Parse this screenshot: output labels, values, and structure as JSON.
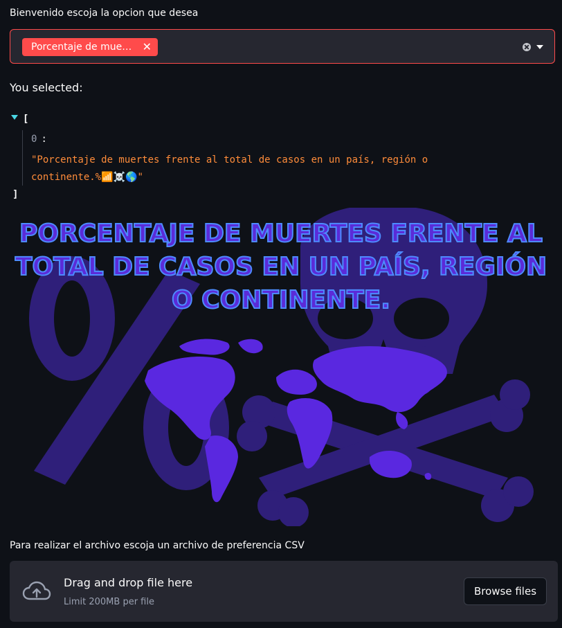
{
  "select": {
    "label": "Bienvenido escoja la opcion que desea",
    "tags": [
      {
        "text": "Porcentaje de muertes frente al total de casos en un país, región o continente.%📶☠️🌎",
        "remove_symbol": "✕"
      }
    ]
  },
  "selected": {
    "heading": "You selected:",
    "open_bracket": "[",
    "close_bracket": "]",
    "items": [
      {
        "index": "0",
        "colon": ":",
        "value": "\"Porcentaje de muertes frente al total de casos en un país, región o continente.%📶☠️🌎\""
      }
    ]
  },
  "banner": {
    "title": "PORCENTAJE DE MUERTES FRENTE AL TOTAL DE CASOS EN UN PAÍS, REGIÓN O CONTINENTE.",
    "colors": {
      "text_fill": "#5b2bd8",
      "text_outline": "#4d8bff",
      "shapes": "#2f1f7a",
      "map": "#5a28e0"
    }
  },
  "uploader": {
    "label": "Para realizar el archivo escoja un archivo de preferencia CSV",
    "title": "Drag and drop file here",
    "limit": "Limit 200MB per file",
    "button": "Browse files"
  },
  "colors": {
    "background": "#0e1117",
    "accent": "#ff4b4b",
    "panel": "#262730"
  }
}
